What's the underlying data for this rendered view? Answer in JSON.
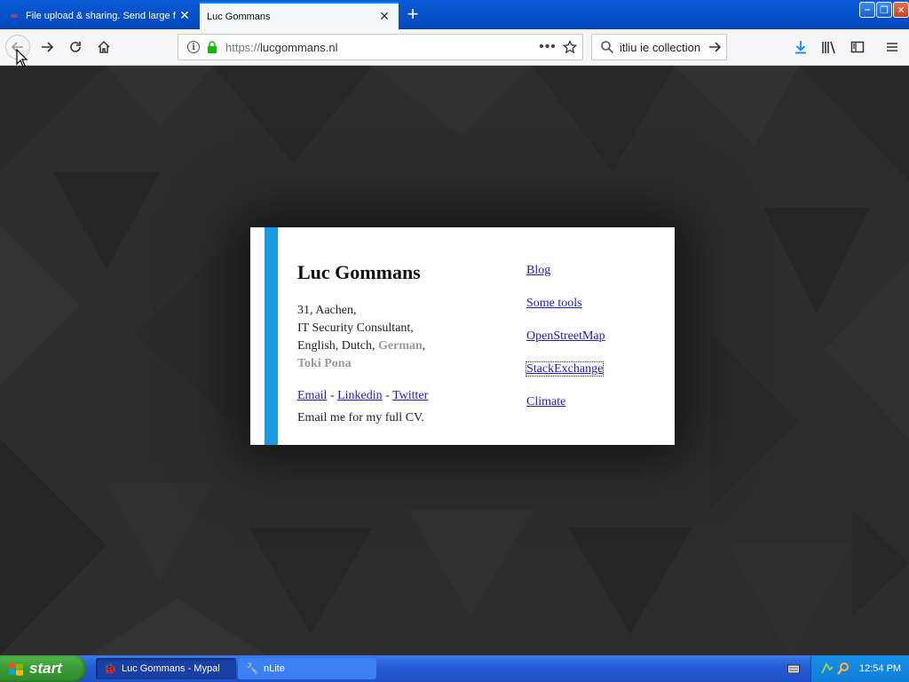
{
  "browser": {
    "tabs": [
      {
        "title": "File upload & sharing. Send large f",
        "active": false
      },
      {
        "title": "Luc Gommans",
        "active": true
      }
    ],
    "url": {
      "scheme": "https://",
      "host": "lucgommans.nl"
    },
    "search_value": "itliu ie collection",
    "page_actions_label": "•••"
  },
  "page": {
    "name": "Luc Gommans",
    "info_line1": "31, Aachen,",
    "info_line2": "IT Security Consultant,",
    "languages_prefix": "English, Dutch, ",
    "lang_german": "German",
    "lang_comma": ",",
    "lang_toki": "Toki Pona",
    "contact": {
      "email": "Email",
      "sep1": " - ",
      "linkedin": "Linkedin",
      "sep2": " - ",
      "twitter": "Twitter"
    },
    "cv_note": "Email me for my full CV.",
    "links": [
      "Blog",
      "Some tools",
      "OpenStreetMap",
      "StackExchange",
      "Climate"
    ]
  },
  "taskbar": {
    "start_label": "start",
    "tasks": [
      {
        "label": "Luc Gommans - Mypal"
      },
      {
        "label": "nLite"
      }
    ],
    "clock": "12:54 PM"
  },
  "colors": {
    "accent_stripe": "#1a9ae0",
    "link": "#1a1acc",
    "titlebar": "#0550c8",
    "page_bg": "#2c2c2c"
  }
}
